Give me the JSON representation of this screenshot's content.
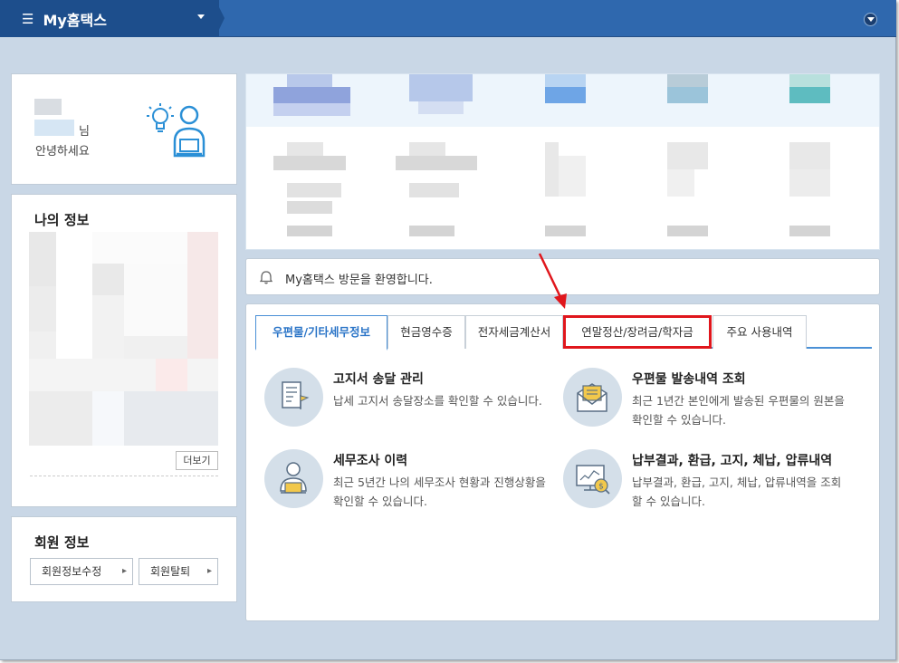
{
  "topbar": {
    "title": "My홈택스"
  },
  "greeting": {
    "suffix": "님",
    "hello": "안녕하세요"
  },
  "myinfo": {
    "title": "나의 정보",
    "more_label": "더보기"
  },
  "member": {
    "title": "회원 정보",
    "edit_label": "회원정보수정",
    "withdraw_label": "회원탈퇴"
  },
  "notice": {
    "text": "My홈택스 방문을 환영합니다."
  },
  "tabs": [
    {
      "label": "우편물/기타세무정보",
      "active": true
    },
    {
      "label": "현금영수증",
      "active": false
    },
    {
      "label": "전자세금계산서",
      "active": false
    },
    {
      "label": "연말정산/장려금/학자금",
      "active": false,
      "highlighted": true
    },
    {
      "label": "주요 사용내역",
      "active": false
    }
  ],
  "services": [
    {
      "title": "고지서 송달 관리",
      "desc": "납세 고지서 송달장소를 확인할 수 있습니다.",
      "icon": "document-flag-icon"
    },
    {
      "title": "우편물 발송내역 조회",
      "desc": "최근 1년간 본인에게 발송된 우편물의 원본을 확인할 수 있습니다.",
      "icon": "envelope-icon"
    },
    {
      "title": "세무조사 이력",
      "desc": "최근 5년간 나의 세무조사 현황과 진행상황을 확인할 수 있습니다.",
      "icon": "person-laptop-icon"
    },
    {
      "title": "납부결과, 환급, 고지, 체납, 압류내역",
      "desc": "납부결과, 환급, 고지, 체납, 압류내역을 조회할 수 있습니다.",
      "icon": "monitor-coin-icon"
    }
  ],
  "colors": {
    "header": "#2f68ae",
    "brand": "#1d4e8c",
    "accent": "#2a74c7",
    "highlight": "#e0161c",
    "background": "#c9d7e6"
  }
}
